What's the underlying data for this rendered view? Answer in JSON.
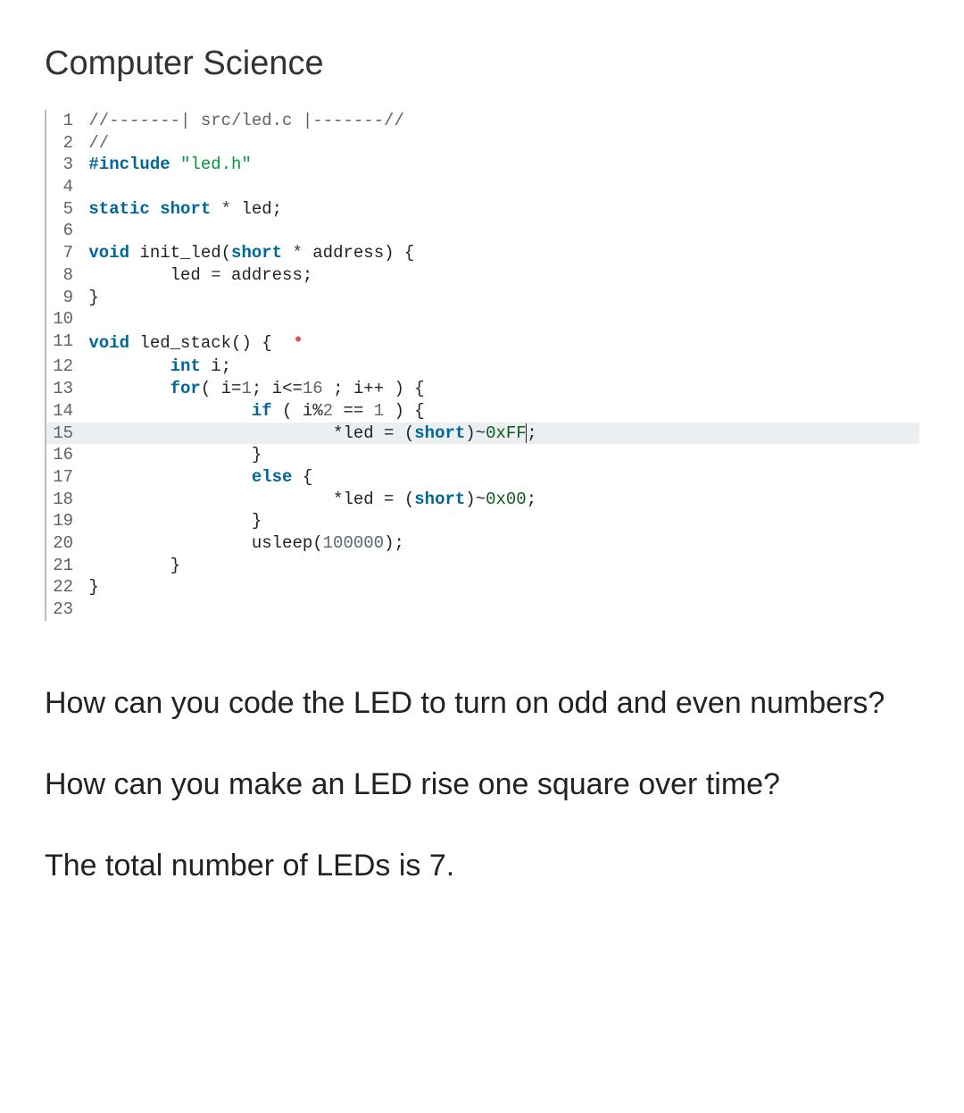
{
  "heading": "Computer Science",
  "code": {
    "lines": [
      {
        "n": 1,
        "hl": false,
        "html": "<span class='c-comment'>//-------| src/led.c |-------//</span>"
      },
      {
        "n": 2,
        "hl": false,
        "html": "<span class='c-comment'>//</span>"
      },
      {
        "n": 3,
        "hl": false,
        "html": "<span class='c-key'>#include</span> <span class='c-str'>\"led.h\"</span>"
      },
      {
        "n": 4,
        "hl": false,
        "html": ""
      },
      {
        "n": 5,
        "hl": false,
        "html": "<span class='c-key'>static</span> <span class='c-type'>short</span> <span class='c-op'>*</span> led;"
      },
      {
        "n": 6,
        "hl": false,
        "html": ""
      },
      {
        "n": 7,
        "hl": false,
        "html": "<span class='c-type'>void</span> <span class='c-fn'>init_led</span>(<span class='c-type'>short</span> <span class='c-op'>*</span> address) {"
      },
      {
        "n": 8,
        "hl": false,
        "html": "        led <span class='c-op'>=</span> address;"
      },
      {
        "n": 9,
        "hl": false,
        "html": "}"
      },
      {
        "n": 10,
        "hl": false,
        "html": ""
      },
      {
        "n": 11,
        "hl": false,
        "html": "<span class='c-type'>void</span> <span class='c-fn'>led_stack</span>() {  <span class='dot'>•</span>"
      },
      {
        "n": 12,
        "hl": false,
        "html": "        <span class='c-type'>int</span> i;"
      },
      {
        "n": 13,
        "hl": false,
        "html": "        <span class='c-key'>for</span>( i=<span class='c-num'>1</span>; i&lt;=<span class='c-num'>16</span> ; i++ ) {"
      },
      {
        "n": 14,
        "hl": false,
        "html": "                <span class='c-key'>if</span> ( i%<span class='c-num'>2</span> == <span class='c-num'>1</span> ) {"
      },
      {
        "n": 15,
        "hl": true,
        "html": "                        *led = (<span class='c-type'>short</span>)~<span class='c-hex'>0xFF</span><span class='cursor'></span>;"
      },
      {
        "n": 16,
        "hl": false,
        "html": "                }"
      },
      {
        "n": 17,
        "hl": false,
        "html": "                <span class='c-key'>else</span> {"
      },
      {
        "n": 18,
        "hl": false,
        "html": "                        *led = (<span class='c-type'>short</span>)~<span class='c-hex'>0x00</span>;"
      },
      {
        "n": 19,
        "hl": false,
        "html": "                }"
      },
      {
        "n": 20,
        "hl": false,
        "html": "                usleep(<span class='c-num'>100000</span>);"
      },
      {
        "n": 21,
        "hl": false,
        "html": "        }"
      },
      {
        "n": 22,
        "hl": false,
        "html": "}"
      },
      {
        "n": 23,
        "hl": false,
        "html": ""
      }
    ]
  },
  "questions": [
    "How can you code the LED to turn on odd and even numbers?",
    "How can you make an LED rise one square over time?",
    "The total number of LEDs is 7."
  ]
}
